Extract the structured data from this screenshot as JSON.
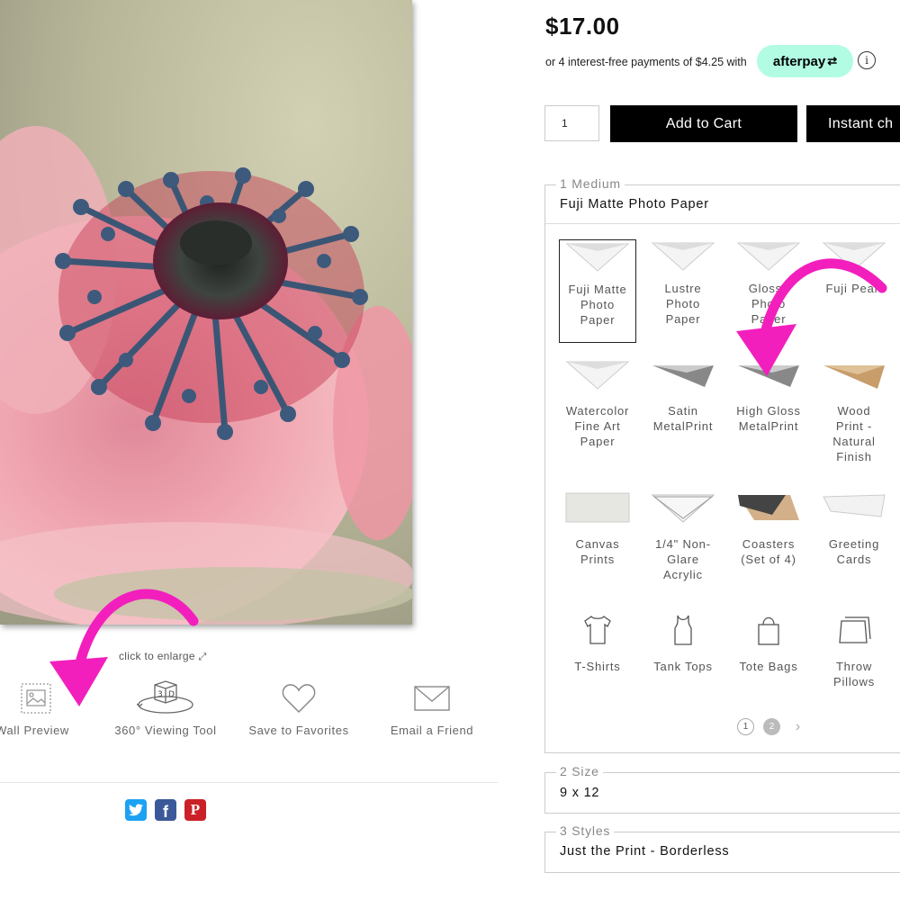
{
  "product": {
    "price": "$17.00",
    "installment_text": "or 4 interest-free payments of $4.25 with",
    "afterpay_label": "afterpay",
    "info_icon": "info-icon",
    "quantity": "1",
    "add_to_cart_label": "Add to Cart",
    "instant_checkout_label": "Instant ch"
  },
  "image_area": {
    "enlarge_text": "click to enlarge",
    "tools": [
      {
        "label": "Wall Preview",
        "icon": "wall-preview-icon"
      },
      {
        "label": "360° Viewing Tool",
        "icon": "3d-view-icon"
      },
      {
        "label": "Save to Favorites",
        "icon": "heart-icon"
      },
      {
        "label": "Email a Friend",
        "icon": "envelope-icon"
      }
    ],
    "social": [
      {
        "name": "twitter",
        "color": "#1da1f2"
      },
      {
        "name": "facebook",
        "color": "#3b5998"
      },
      {
        "name": "pinterest",
        "color": "#cb2027"
      }
    ]
  },
  "medium": {
    "legend": "1 Medium",
    "selected": "Fuji Matte Photo Paper",
    "options": [
      [
        "Fuji Matte",
        "Photo",
        "Paper"
      ],
      [
        "Lustre",
        "Photo",
        "Paper"
      ],
      [
        "Glossy",
        "Photo",
        "Paper"
      ],
      [
        "Fuji Pearl"
      ],
      [
        "Watercolor",
        "Fine Art",
        "Paper"
      ],
      [
        "Satin",
        "MetalPrint"
      ],
      [
        "High Gloss",
        "MetalPrint"
      ],
      [
        "Wood",
        "Print -",
        "Natural",
        "Finish"
      ],
      [
        "Canvas",
        "Prints"
      ],
      [
        "1/4\" Non-",
        "Glare",
        "Acrylic"
      ],
      [
        "Coasters",
        "(Set of 4)"
      ],
      [
        "Greeting",
        "Cards"
      ],
      [
        "T-Shirts"
      ],
      [
        "Tank Tops"
      ],
      [
        "Tote Bags"
      ],
      [
        "Throw",
        "Pillows"
      ]
    ],
    "pages": [
      "1",
      "2"
    ],
    "current_page": "2"
  },
  "size": {
    "legend": "2 Size",
    "value": "9 x 12"
  },
  "styles": {
    "legend": "3 Styles",
    "value": "Just the Print - Borderless"
  },
  "colors": {
    "accent_arrow": "#f21fbd",
    "afterpay_bg": "#b2fce4"
  }
}
